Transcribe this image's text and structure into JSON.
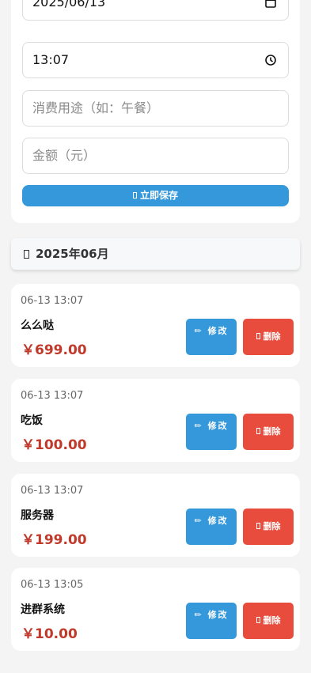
{
  "form": {
    "date_value": "2025/06/13",
    "time_value": "13:07",
    "purpose_placeholder": "消费用途（如：午餐）",
    "amount_placeholder": "金额（元）",
    "save_label": "立即保存",
    "date_icon": "calendar-icon",
    "time_icon": "clock-icon"
  },
  "month_header": {
    "label": "2025年06月"
  },
  "records": [
    {
      "time": "06-13 13:07",
      "purpose": "么么哒",
      "amount": "￥699.00",
      "edit_label": "✏ 修改",
      "delete_label": "删除"
    },
    {
      "time": "06-13 13:07",
      "purpose": "吃饭",
      "amount": "￥100.00",
      "edit_label": "✏ 修改",
      "delete_label": "删除"
    },
    {
      "time": "06-13 13:07",
      "purpose": "服务器",
      "amount": "￥199.00",
      "edit_label": "✏ 修改",
      "delete_label": "删除"
    },
    {
      "time": "06-13 13:05",
      "purpose": "进群系统",
      "amount": "￥10.00",
      "edit_label": "✏ 修改",
      "delete_label": "删除"
    }
  ],
  "colors": {
    "primary": "#3498db",
    "danger": "#e74c3c",
    "amount": "#c0392b",
    "background": "#f4f4f4"
  }
}
